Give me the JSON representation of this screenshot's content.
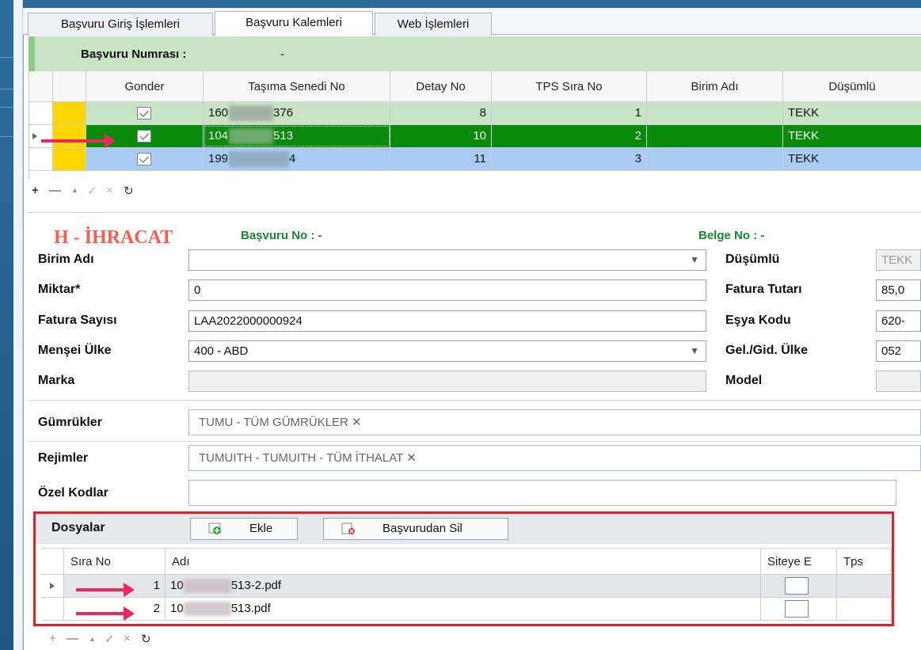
{
  "tabs": [
    {
      "label": "Başvuru Giriş İşlemleri",
      "active": false
    },
    {
      "label": "Başvuru Kalemleri",
      "active": true
    },
    {
      "label": "Web İşlemleri",
      "active": false
    }
  ],
  "header": {
    "label": "Başvuru Numrası :",
    "value": "-"
  },
  "grid": {
    "columns": [
      "Gonder",
      "Taşıma Senedi No",
      "Detay No",
      "TPS Sıra No",
      "Birim Adı",
      "Düşümlü"
    ],
    "rows": [
      {
        "senet_prefix": "160",
        "senet_suffix": "376",
        "detay": "8",
        "tps": "1",
        "birim": "",
        "dusumlu": "TEKK",
        "bg": "#c9e4c5"
      },
      {
        "senet_prefix": "104",
        "senet_suffix": "513",
        "detay": "10",
        "tps": "2",
        "birim": "",
        "dusumlu": "TEKK",
        "bg": "#0a8a0a"
      },
      {
        "senet_prefix": "199",
        "senet_suffix": "4",
        "detay": "11",
        "tps": "3",
        "birim": "",
        "dusumlu": "TEKK",
        "bg": "#a9cdf2"
      }
    ],
    "nav": {
      "add": "+",
      "remove": "—",
      "up": "▲",
      "accept": "✓",
      "cancel": "×",
      "refresh": "↻"
    }
  },
  "form": {
    "title": "H - İHRACAT",
    "basvuru_no": "Başvuru No : -",
    "belge_no": "Belge No : -",
    "fields": {
      "birim_adi": {
        "label": "Birim Adı",
        "value": ""
      },
      "miktar": {
        "label": "Miktar*",
        "value": "0"
      },
      "fatura_sayisi": {
        "label": "Fatura Sayısı",
        "value": "LAA2022000000924"
      },
      "mensei_ulke": {
        "label": "Menşei Ülke",
        "value": "400  - ABD"
      },
      "marka": {
        "label": "Marka",
        "value": ""
      },
      "dusumlu": {
        "label": "Düşümlü",
        "value": "TEKK"
      },
      "fatura_tutari": {
        "label": "Fatura Tutarı",
        "value": "85,0"
      },
      "esya_kodu": {
        "label": "Eşya Kodu",
        "value": "620-"
      },
      "gel_gid_ulke": {
        "label": "Gel./Gid. Ülke",
        "value": "052"
      },
      "model": {
        "label": "Model",
        "value": ""
      }
    },
    "gumrukler": {
      "label": "Gümrükler",
      "token": "TUMU - TÜM GÜMRÜKLER ✕"
    },
    "rejimler": {
      "label": "Rejimler",
      "token": "TUMUITH - TUMUITH - TÜM İTHALAT ✕"
    },
    "ozel_kodlar": {
      "label": "Özel Kodlar",
      "value": ""
    }
  },
  "files": {
    "label": "Dosyalar",
    "add_button": "Ekle",
    "delete_button": "Başvurudan Sil",
    "columns": [
      "Sıra No",
      "Adı",
      "Siteye E",
      "Tps"
    ],
    "rows": [
      {
        "sira": "1",
        "prefix": "10",
        "suffix": "513-2.pdf"
      },
      {
        "sira": "2",
        "prefix": "10",
        "suffix": "513.pdf"
      }
    ]
  },
  "colors": {
    "highlight_border": "#e0202f",
    "arrow": "#f02660",
    "title": "#ff5a4a",
    "green_label": "#178a2e"
  }
}
